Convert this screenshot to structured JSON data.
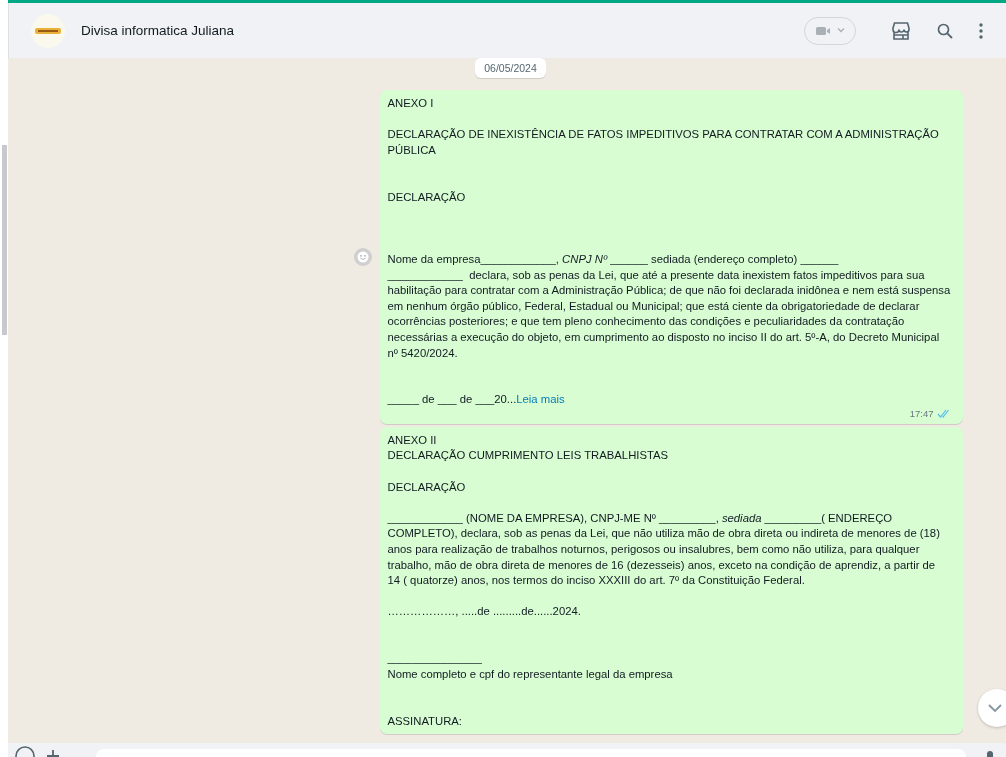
{
  "header": {
    "contact_name": "Divisa informatica Juliana"
  },
  "date_chip": "06/05/2024",
  "messages": [
    {
      "text": "ANEXO I\n\nDECLARAÇÃO DE INEXISTÊNCIA DE FATOS IMPEDITIVOS PARA CONTRATAR COM A ADMINISTRAÇÃO PÚBLICA\n\n\nDECLARAÇÃO\n\n\n\nNome da empresa____________, *CNPJ Nº* ______ sediada (endereço completo) ______\n____________  declara, sob as penas da Lei, que até a presente data inexistem fatos impeditivos para sua habilitação para contratar com a Administração Pública; de que não foi declarada inidônea e nem está suspensa em nenhum órgão público, Federal, Estadual ou Municipal; que está ciente da obrigatoriedade de declarar ocorrências posteriores; e que tem pleno conhecimento das condições e peculiaridades da contratação necessárias a execução do objeto, em cumprimento ao disposto no inciso II do art. 5º-A, do Decreto Municipal nº 5420/2024.\n\n\n_____ de ___ de ___20...",
      "read_more": "Leia mais",
      "time": "17:47",
      "read": true
    },
    {
      "text": "ANEXO II\nDECLARAÇÃO CUMPRIMENTO LEIS TRABALHISTAS\n\nDECLARAÇÃO\n\n____________ (NOME DA EMPRESA), CNPJ-ME Nº _________, *sediada* _________( ENDEREÇO COMPLETO), declara, sob as penas da Lei, que não utiliza mão de obra direta ou indireta de menores de (18) anos para realização de trabalhos noturnos, perigosos ou insalubres, bem como não utiliza, para qualquer trabalho, mão de obra direta de menores de 16 (dezesseis) anos, exceto na condição de aprendiz, a partir de 14 ( quatorze) anos, nos termos do inciso XXXIII do art. 7º da Constituição Federal.\n\n………………, .....de .........de......2024.\n\n\n_______________\nNome completo e cpf do representante legal da empresa\n\n\nASSINATURA:"
    }
  ]
}
